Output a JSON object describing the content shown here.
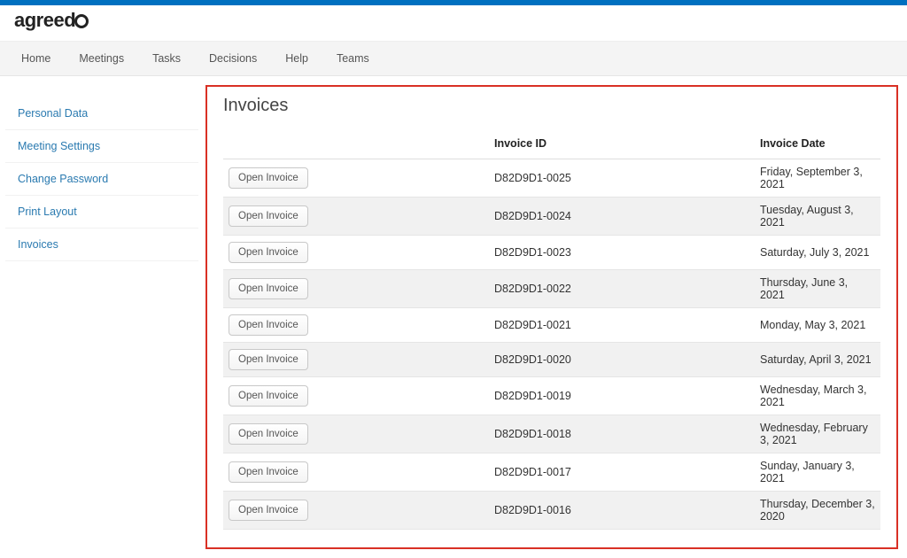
{
  "brand": {
    "prefix": "agreed",
    "suffix_icon": "refresh-circle"
  },
  "nav": [
    "Home",
    "Meetings",
    "Tasks",
    "Decisions",
    "Help",
    "Teams"
  ],
  "sidebar": [
    "Personal Data",
    "Meeting Settings",
    "Change Password",
    "Print Layout",
    "Invoices"
  ],
  "page": {
    "title": "Invoices"
  },
  "table": {
    "open_label": "Open Invoice",
    "headers": {
      "id": "Invoice ID",
      "date": "Invoice Date"
    },
    "rows": [
      {
        "id": "D82D9D1-0025",
        "date": "Friday, September 3, 2021"
      },
      {
        "id": "D82D9D1-0024",
        "date": "Tuesday, August 3, 2021"
      },
      {
        "id": "D82D9D1-0023",
        "date": "Saturday, July 3, 2021"
      },
      {
        "id": "D82D9D1-0022",
        "date": "Thursday, June 3, 2021"
      },
      {
        "id": "D82D9D1-0021",
        "date": "Monday, May 3, 2021"
      },
      {
        "id": "D82D9D1-0020",
        "date": "Saturday, April 3, 2021"
      },
      {
        "id": "D82D9D1-0019",
        "date": "Wednesday, March 3, 2021"
      },
      {
        "id": "D82D9D1-0018",
        "date": "Wednesday, February 3, 2021"
      },
      {
        "id": "D82D9D1-0017",
        "date": "Sunday, January 3, 2021"
      },
      {
        "id": "D82D9D1-0016",
        "date": "Thursday, December 3, 2020"
      }
    ]
  }
}
